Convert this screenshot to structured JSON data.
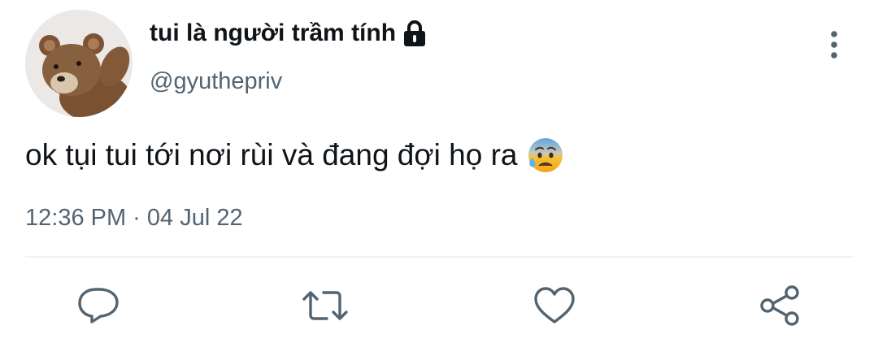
{
  "tweet": {
    "author": {
      "display_name": "tui là người trầm tính",
      "handle": "@gyuthepriv",
      "protected_icon": "lock-icon",
      "avatar_icon": "teddy-bear-avatar"
    },
    "text": "ok tụi tui tới nơi rùi và đang đợi họ ra",
    "emoji": "anxious-face-with-sweat",
    "timestamp": "12:36 PM · 04 Jul 22"
  },
  "actions": [
    {
      "name": "reply",
      "icon": "reply-icon"
    },
    {
      "name": "retweet",
      "icon": "retweet-icon"
    },
    {
      "name": "like",
      "icon": "heart-icon"
    },
    {
      "name": "share",
      "icon": "share-icon"
    }
  ],
  "menu": {
    "icon": "more-vertical-icon"
  },
  "colors": {
    "text_primary": "#0f1419",
    "text_secondary": "#536471",
    "icon": "#536471",
    "divider": "#eff3f4"
  }
}
